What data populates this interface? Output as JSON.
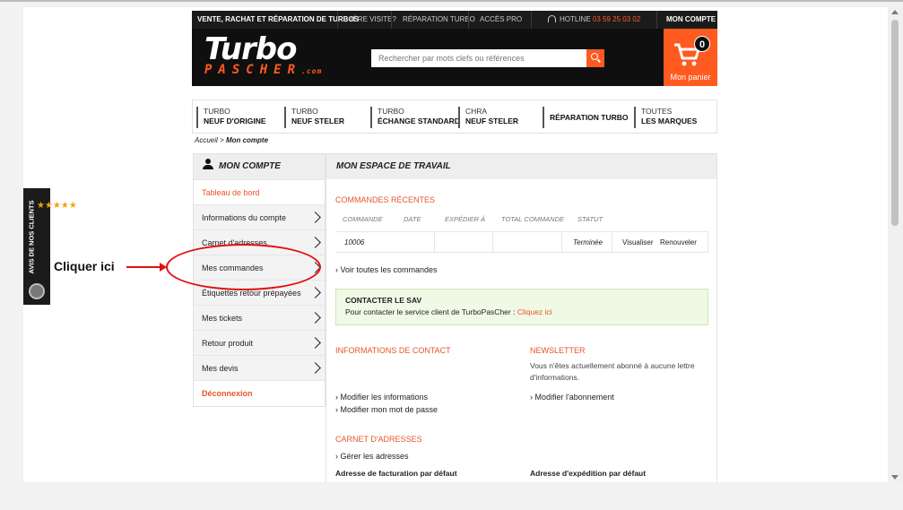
{
  "topbar": {
    "slogan": "VENTE, RACHAT ET RÉPARATION DE TURBOS",
    "first_visit": "1ÈRE VISITE?",
    "repair": "RÉPARATION TURBO",
    "pro": "ACCÈS PRO",
    "hotline_label": "HOTLINE",
    "hotline_number": "03 59 25 03 02",
    "account": "MON COMPTE"
  },
  "logo": {
    "line1": "Turbo",
    "line2": "PASCHER",
    "suffix": ".com"
  },
  "search": {
    "placeholder": "Rechercher par mots clefs ou références"
  },
  "cart": {
    "label": "Mon panier",
    "count": "0"
  },
  "categories": [
    {
      "l1": "TURBO",
      "l2": "NEUF D'ORIGINE"
    },
    {
      "l1": "TURBO",
      "l2": "NEUF STELER"
    },
    {
      "l1": "TURBO",
      "l2": "ÉCHANGE STANDARD"
    },
    {
      "l1": "CHRA",
      "l2": "NEUF STELER"
    },
    {
      "l1": "RÉPARATION TURBO"
    },
    {
      "l1": "TOUTES",
      "l2": "LES MARQUES"
    }
  ],
  "breadcrumb": {
    "home": "Accueil",
    "sep": ">",
    "current": "Mon compte"
  },
  "sidebar": {
    "title": "MON COMPTE",
    "items": [
      "Tableau de bord",
      "Informations du compte",
      "Carnet d'adresses",
      "Mes commandes",
      "Étiquettes retour prépayées",
      "Mes tickets",
      "Retour produit",
      "Mes devis",
      "Déconnexion"
    ]
  },
  "main": {
    "title": "MON ESPACE DE TRAVAIL",
    "recent_orders": "COMMANDES RÉCENTES",
    "columns": [
      "COMMANDE",
      "DATE",
      "EXPÉDIER À",
      "TOTAL COMMANDE",
      "STATUT"
    ],
    "order": {
      "id": "10006",
      "status": "Terminée",
      "view": "Visualiser",
      "renew": "Renouveler"
    },
    "all_orders": "Voir toutes les commandes",
    "sav_title": "CONTACTER LE SAV",
    "sav_text": "Pour contacter le service client de TurboPasCher : ",
    "sav_link": "Cliquez ici",
    "contact_title": "INFORMATIONS DE CONTACT",
    "newsletter_title": "NEWSLETTER",
    "newsletter_text": "Vous n'êtes actuellement abonné à aucune lettre d'informations.",
    "modify_info": "Modifier les informations",
    "modify_pwd": "Modifier mon mot de passe",
    "modify_sub": "Modifier l'abonnement",
    "address_title": "CARNET D'ADRESSES",
    "manage_addr": "Gérer les adresses",
    "billing_addr": "Adresse de facturation par défaut",
    "shipping_addr": "Adresse d'expédition par défaut"
  },
  "reviews": {
    "label": "AVIS DE NOS CLIENTS",
    "stars": "★★★★★"
  },
  "annotation": {
    "text": "Cliquer ici"
  }
}
